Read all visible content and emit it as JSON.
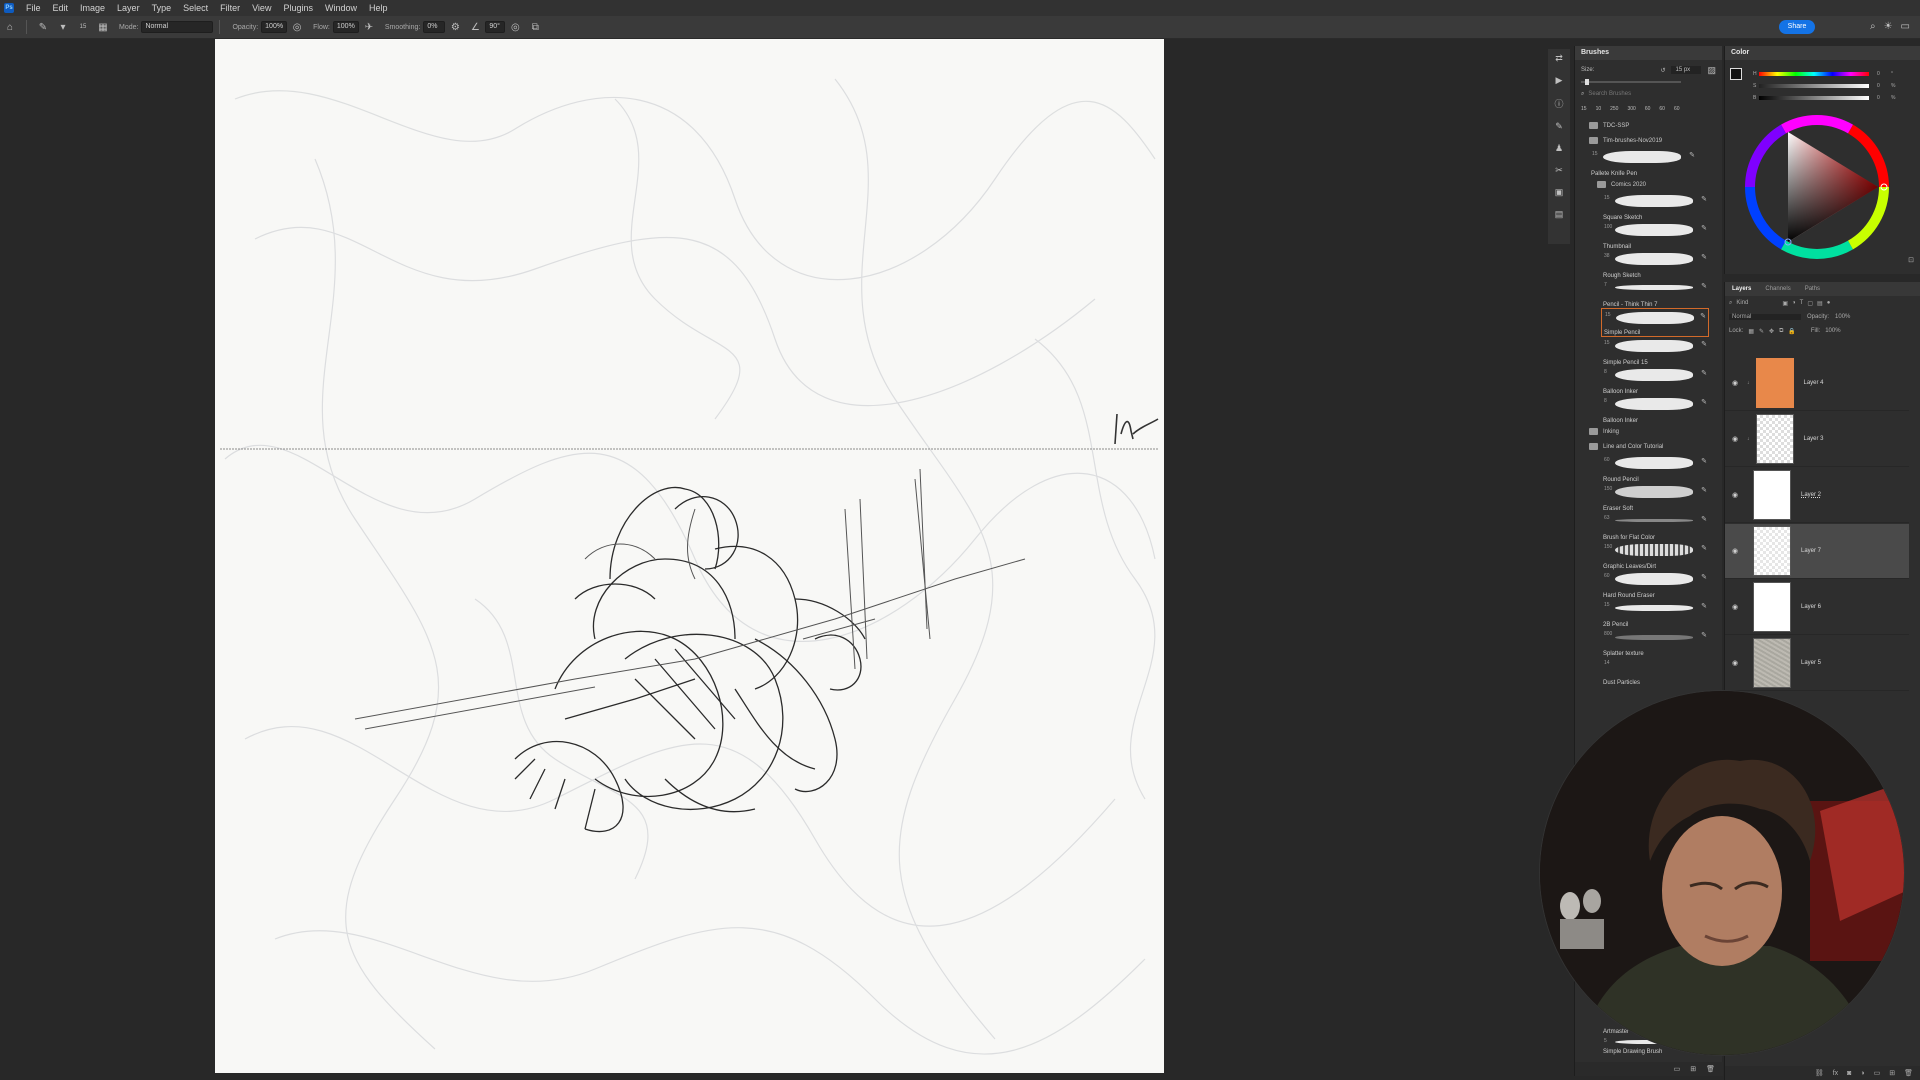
{
  "menu": [
    "File",
    "Edit",
    "Image",
    "Layer",
    "Type",
    "Select",
    "Filter",
    "View",
    "Plugins",
    "Window",
    "Help"
  ],
  "options": {
    "brush_size": "15",
    "mode_label": "Mode:",
    "mode_value": "Normal",
    "opacity_label": "Opacity:",
    "opacity_value": "100%",
    "flow_label": "Flow:",
    "flow_value": "100%",
    "smoothing_label": "Smoothing:",
    "smoothing_value": "0%",
    "angle_value": "90°"
  },
  "share_label": "Share",
  "brushes_panel": {
    "title": "Brushes",
    "size_label": "Size:",
    "size_value": "15 px",
    "search_placeholder": "Search Brushes",
    "presets": [
      "15",
      "10",
      "250",
      "300",
      "60",
      "60",
      "60"
    ],
    "folders": {
      "tdc": "TDC-SSP",
      "tim": "Tim-brushes-Nov2019",
      "comics": "Comics 2020",
      "inking": "Inking",
      "line_color": "Line and Color Tutorial"
    },
    "tim_items": [
      {
        "size": "15",
        "name": "Pallete Knife Pen"
      }
    ],
    "comics_items": [
      {
        "size": "15",
        "name": "Square Sketch"
      },
      {
        "size": "100",
        "name": "Thumbnail"
      },
      {
        "size": "38",
        "name": "Rough Sketch"
      },
      {
        "size": "7",
        "name": "Pencil - Think Thin 7"
      },
      {
        "size": "15",
        "name": "Simple Pencil"
      },
      {
        "size": "15",
        "name": "Simple Pencil 15"
      },
      {
        "size": "8",
        "name": "Balloon Inker"
      },
      {
        "size": "8",
        "name": "Balloon Inker"
      }
    ],
    "line_items": [
      {
        "size": "60",
        "name": "Round Pencil"
      },
      {
        "size": "150",
        "name": "Eraser Soft"
      },
      {
        "size": "63",
        "name": "Brush for Flat Color"
      },
      {
        "size": "150",
        "name": "Graphic Leaves/Dirt"
      },
      {
        "size": "60",
        "name": "Hard Round Eraser"
      },
      {
        "size": "15",
        "name": "2B Pencil"
      },
      {
        "size": "800",
        "name": "Splatter texture"
      },
      {
        "size": "14",
        "name": "Dust Particles"
      }
    ],
    "bottom_items": [
      {
        "size": "20",
        "name": "Artmaster"
      },
      {
        "size": "5",
        "name": "Simple Drawing Brush"
      }
    ]
  },
  "color_panel": {
    "title": "Color",
    "slider_labels": [
      "H",
      "S",
      "B"
    ],
    "slider_values": [
      "0",
      "0",
      "0"
    ],
    "units": [
      "°",
      "%",
      "%"
    ]
  },
  "layers_panel": {
    "tabs": [
      "Layers",
      "Channels",
      "Paths"
    ],
    "kind_label": "Kind",
    "blend_mode": "Normal",
    "opacity_label": "Opacity:",
    "opacity_value": "100%",
    "lock_label": "Lock:",
    "fill_label": "Fill:",
    "fill_value": "100%",
    "layers": [
      {
        "name": "Layer 4"
      },
      {
        "name": "Layer 3"
      },
      {
        "name": "Layer 2"
      },
      {
        "name": "Layer 7"
      },
      {
        "name": "Layer 6"
      },
      {
        "name": "Layer 5"
      }
    ]
  },
  "colors": {
    "accent": "#1473e6",
    "layer4_fill": "#e8884a",
    "selected_brush_border": "#d26a2a"
  }
}
